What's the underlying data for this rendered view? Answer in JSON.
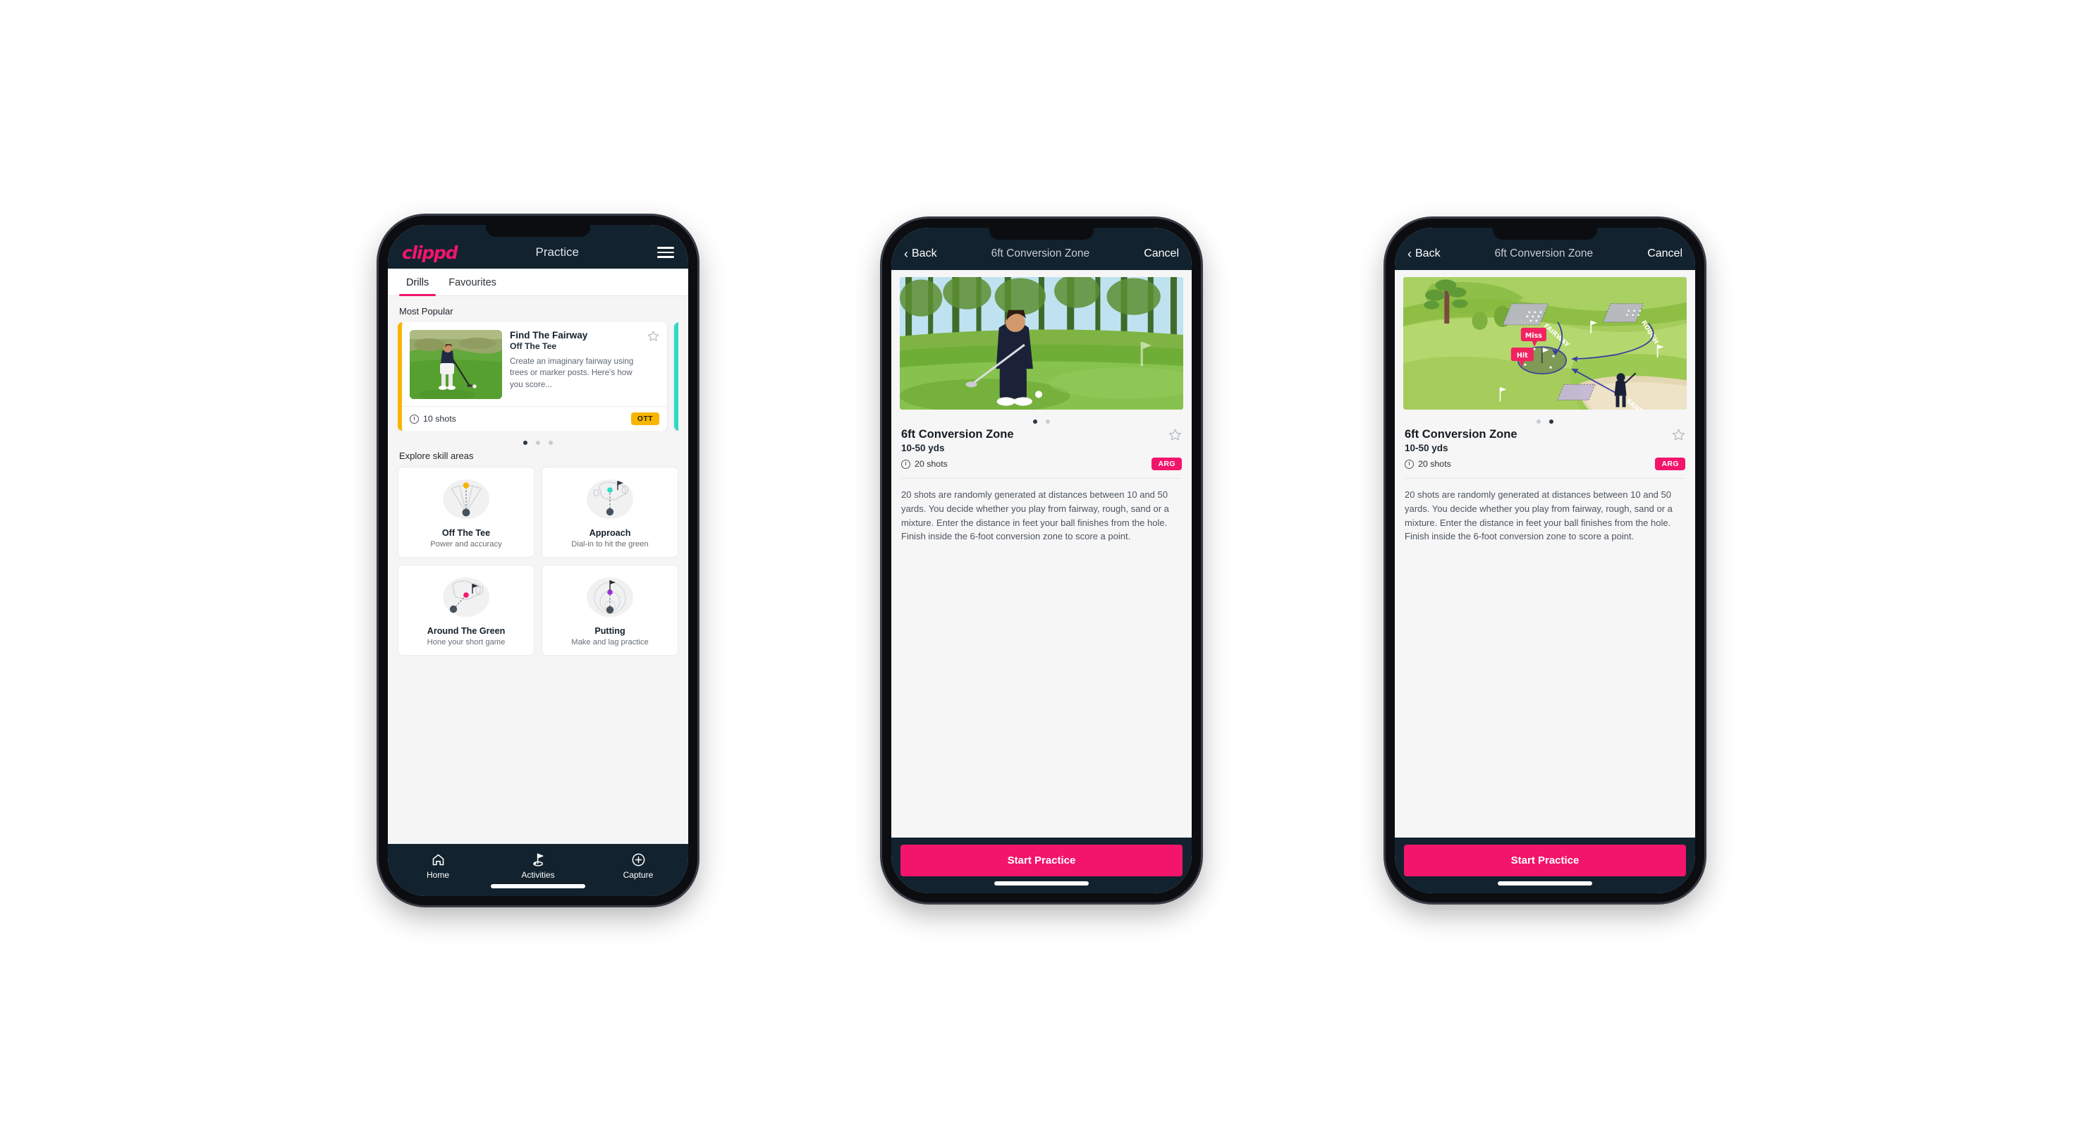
{
  "app": {
    "brand": "clippd",
    "accent_pink": "#f2156b",
    "dark_navy": "#12222e",
    "amber": "#f7b500",
    "teal": "#2fd9c5"
  },
  "phone1": {
    "appbar": {
      "brand": "clippd",
      "title": "Practice",
      "menu_icon": "hamburger-icon"
    },
    "tabs": [
      {
        "label": "Drills",
        "active": true
      },
      {
        "label": "Favourites",
        "active": false
      }
    ],
    "most_popular_label": "Most Popular",
    "featured_drill": {
      "title": "Find The Fairway",
      "subtitle": "Off The Tee",
      "description": "Create an imaginary fairway using trees or marker posts. Here's how you score...",
      "shots": "10 shots",
      "badge": "OTT",
      "badge_color": "#f7b500",
      "accent_color": "#f7b500",
      "star_icon": "star-outline-icon",
      "clock_icon": "clock-icon"
    },
    "carousel_dots": {
      "count": 3,
      "active_index": 0
    },
    "explore_label": "Explore skill areas",
    "skills": [
      {
        "name": "Off The Tee",
        "desc": "Power and accuracy",
        "icon": "tee-fan-icon",
        "dot_color": "#f7b500"
      },
      {
        "name": "Approach",
        "desc": "Dial-in to hit the green",
        "icon": "green-approach-icon",
        "dot_color": "#2fd9c5"
      },
      {
        "name": "Around The Green",
        "desc": "Hone your short game",
        "icon": "chip-green-icon",
        "dot_color": "#f2156b"
      },
      {
        "name": "Putting",
        "desc": "Make and lag practice",
        "icon": "putting-rings-icon",
        "dot_color": "#9b30d9"
      }
    ],
    "tabbar": [
      {
        "label": "Home",
        "icon": "home-icon",
        "active": false
      },
      {
        "label": "Activities",
        "icon": "golf-flag-icon",
        "active": true
      },
      {
        "label": "Capture",
        "icon": "plus-circle-icon",
        "active": false
      }
    ]
  },
  "phone2": {
    "navbar": {
      "back_label": "Back",
      "back_icon": "chevron-left-icon",
      "title": "6ft Conversion Zone",
      "cancel_label": "Cancel"
    },
    "hero": {
      "type": "photo",
      "alt": "golfer-chipping-photo"
    },
    "carousel_dots": {
      "count": 2,
      "active_index": 0
    },
    "detail": {
      "title": "6ft Conversion Zone",
      "yardage": "10-50 yds",
      "shots": "20 shots",
      "badge": "ARG",
      "badge_color": "#f2156b",
      "star_icon": "star-outline-icon",
      "clock_icon": "clock-icon",
      "description": "20 shots are randomly generated at distances between 10 and 50 yards. You decide whether you play from fairway, rough, sand or a mixture. Enter the distance in feet your ball finishes from the hole. Finish inside the 6-foot conversion zone to score a point."
    },
    "cta_label": "Start Practice"
  },
  "phone3": {
    "navbar": {
      "back_label": "Back",
      "back_icon": "chevron-left-icon",
      "title": "6ft Conversion Zone",
      "cancel_label": "Cancel"
    },
    "hero": {
      "type": "illustration",
      "alt": "golf-course-diagram",
      "labels": [
        "FAIRWAY",
        "ROUGH",
        "SAND"
      ],
      "pins": [
        {
          "label": "Miss",
          "color": "#f2156b"
        },
        {
          "label": "Hit",
          "color": "#f2156b"
        }
      ]
    },
    "carousel_dots": {
      "count": 2,
      "active_index": 1
    },
    "detail": {
      "title": "6ft Conversion Zone",
      "yardage": "10-50 yds",
      "shots": "20 shots",
      "badge": "ARG",
      "badge_color": "#f2156b",
      "star_icon": "star-outline-icon",
      "clock_icon": "clock-icon",
      "description": "20 shots are randomly generated at distances between 10 and 50 yards. You decide whether you play from fairway, rough, sand or a mixture. Enter the distance in feet your ball finishes from the hole. Finish inside the 6-foot conversion zone to score a point."
    },
    "cta_label": "Start Practice"
  }
}
